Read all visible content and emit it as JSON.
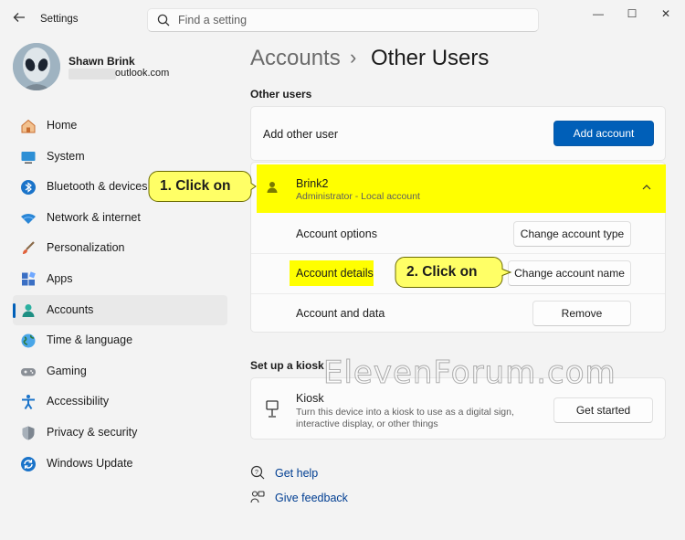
{
  "window": {
    "app_title": "Settings",
    "minimize": "—",
    "maximize": "☐",
    "close": "✕"
  },
  "search": {
    "placeholder": "Find a setting"
  },
  "profile": {
    "name": "Shawn Brink",
    "email_suffix": "outlook.com"
  },
  "sidebar": {
    "items": [
      {
        "label": "Home",
        "icon": "home-icon"
      },
      {
        "label": "System",
        "icon": "system-icon"
      },
      {
        "label": "Bluetooth & devices",
        "icon": "bluetooth-icon"
      },
      {
        "label": "Network & internet",
        "icon": "wifi-icon"
      },
      {
        "label": "Personalization",
        "icon": "brush-icon"
      },
      {
        "label": "Apps",
        "icon": "apps-icon"
      },
      {
        "label": "Accounts",
        "icon": "accounts-icon",
        "active": true
      },
      {
        "label": "Time & language",
        "icon": "globe-icon"
      },
      {
        "label": "Gaming",
        "icon": "gamepad-icon"
      },
      {
        "label": "Accessibility",
        "icon": "accessibility-icon"
      },
      {
        "label": "Privacy & security",
        "icon": "shield-icon"
      },
      {
        "label": "Windows Update",
        "icon": "update-icon"
      }
    ]
  },
  "breadcrumb": {
    "parent": "Accounts",
    "separator": "›",
    "current": "Other Users"
  },
  "other_users": {
    "section_title": "Other users",
    "add_label": "Add other user",
    "add_button": "Add account",
    "user": {
      "name": "Brink2",
      "subtitle": "Administrator - Local account",
      "rows": [
        {
          "label": "Account options",
          "button": "Change account type"
        },
        {
          "label": "Account details",
          "button": "Change account name"
        },
        {
          "label": "Account and data",
          "button": "Remove"
        }
      ]
    }
  },
  "kiosk": {
    "section_title": "Set up a kiosk",
    "title": "Kiosk",
    "description": "Turn this device into a kiosk to use as a digital sign, interactive display, or other things",
    "button": "Get started"
  },
  "help": {
    "get_help": "Get help",
    "give_feedback": "Give feedback"
  },
  "annotations": {
    "step1": "1. Click on",
    "step2": "2. Click on"
  },
  "watermark": "ElevenForum.com",
  "colors": {
    "accent": "#005fb8",
    "highlight": "#ffff00",
    "callout_fill": "#ffff66"
  }
}
